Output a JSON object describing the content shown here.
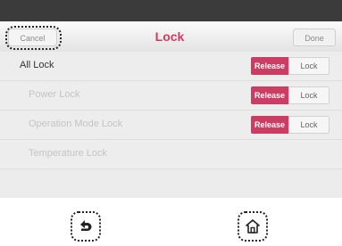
{
  "header": {
    "cancel_label": "Cancel",
    "title": "Lock",
    "done_label": "Done"
  },
  "rows": [
    {
      "label": "All Lock",
      "release_label": "Release",
      "lock_label": "Lock",
      "enabled": true
    },
    {
      "label": "Power Lock",
      "release_label": "Release",
      "lock_label": "Lock",
      "enabled": false
    },
    {
      "label": "Operation Mode Lock",
      "release_label": "Release",
      "lock_label": "Lock",
      "enabled": false
    },
    {
      "label": "Temperature Lock",
      "enabled": false
    }
  ],
  "nav": {
    "back_icon": "back-arrow-icon",
    "home_icon": "home-icon"
  },
  "colors": {
    "accent": "#cd3c63",
    "title": "#d23a5e",
    "topbar": "#3b3b3b"
  }
}
